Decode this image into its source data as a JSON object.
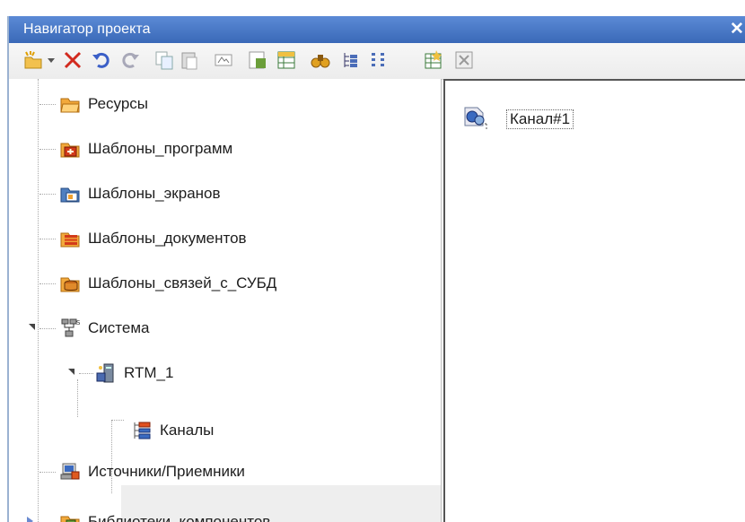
{
  "window": {
    "title": "Навигатор проекта",
    "close_glyph": "✕"
  },
  "toolbar": {
    "buttons": [
      {
        "icon": "new-item-icon"
      },
      {
        "icon": "dropdown-arrow-icon"
      },
      {
        "icon": "delete-icon"
      },
      {
        "icon": "undo-icon"
      },
      {
        "icon": "redo-icon"
      },
      {
        "icon": "copy-icon"
      },
      {
        "icon": "paste-icon"
      },
      {
        "icon": "rename-icon"
      },
      {
        "icon": "properties-icon"
      },
      {
        "icon": "table-icon"
      },
      {
        "icon": "find-icon"
      },
      {
        "icon": "tree-view-icon"
      },
      {
        "icon": "list-view-icon"
      },
      {
        "icon": "wizard-icon"
      },
      {
        "icon": "close-doc-icon"
      }
    ]
  },
  "tree": {
    "items": [
      {
        "label": "Ресурсы",
        "icon": "folder-resources-icon"
      },
      {
        "label": "Шаблоны_программ",
        "icon": "program-templates-icon"
      },
      {
        "label": "Шаблоны_экранов",
        "icon": "screen-templates-icon"
      },
      {
        "label": "Шаблоны_документов",
        "icon": "document-templates-icon"
      },
      {
        "label": "Шаблоны_связей_с_СУБД",
        "icon": "dbms-templates-icon"
      },
      {
        "label": "Система",
        "icon": "system-network-icon",
        "expanded": true
      },
      {
        "label": "RTM_1",
        "icon": "rtm-node-icon",
        "expanded": true
      },
      {
        "label": "Каналы",
        "icon": "channels-icon",
        "selected": true
      },
      {
        "label": "Источники/Приемники",
        "icon": "sources-receivers-icon"
      },
      {
        "label": "Библиотеки_компонентов",
        "icon": "component-libraries-icon",
        "collapsed": true
      }
    ]
  },
  "content": {
    "items": [
      {
        "label": "Канал#1",
        "icon": "channel-item-icon"
      }
    ]
  },
  "colors": {
    "title_bar": "#3a69b8",
    "selection": "#eeeeee",
    "delete_red": "#d22a1f"
  }
}
